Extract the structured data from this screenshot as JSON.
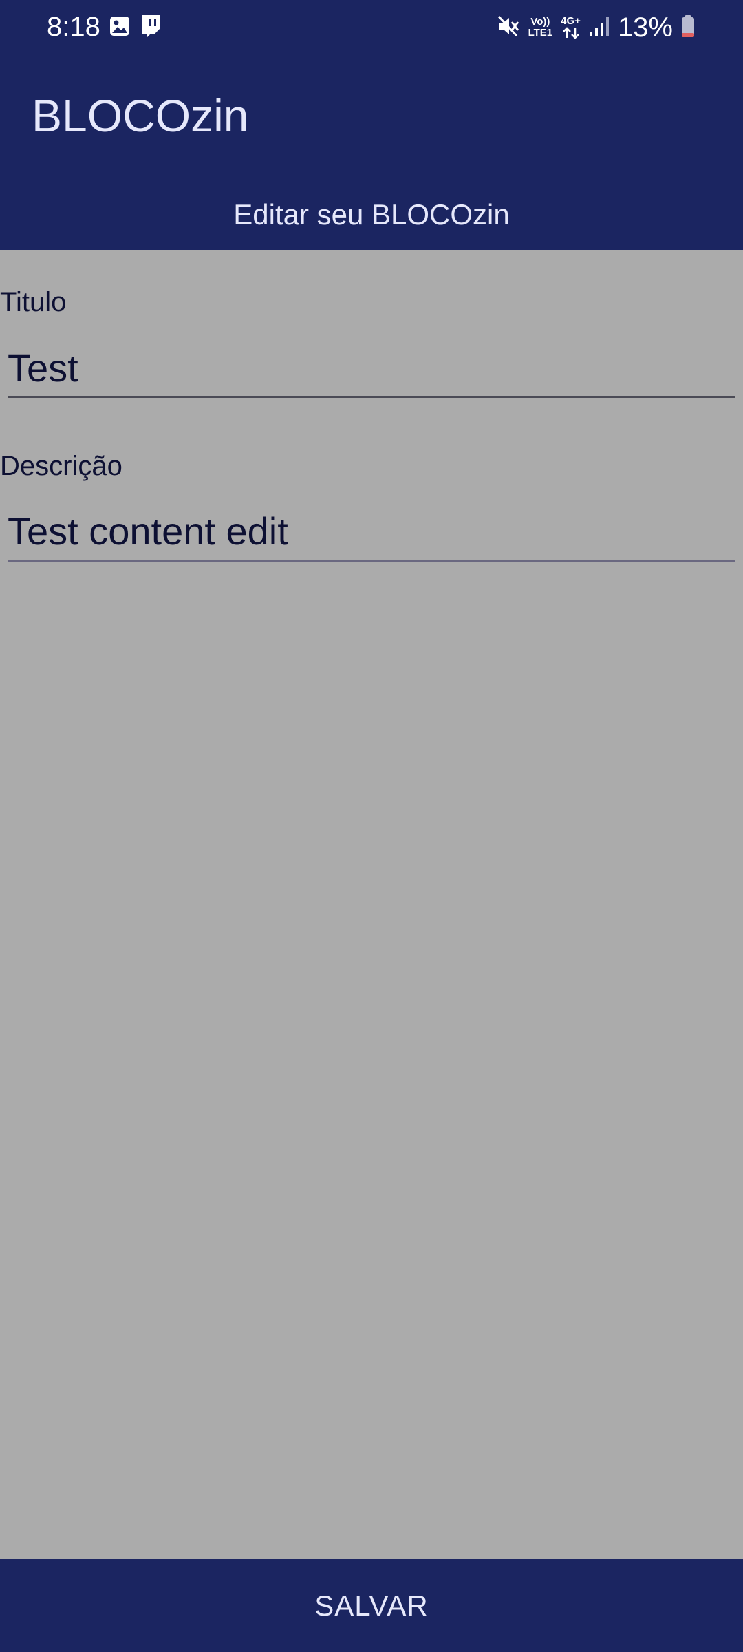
{
  "status_bar": {
    "time": "8:18",
    "battery_percent": "13%",
    "network": {
      "volte_top": "Vo))",
      "volte_bottom": "LTE1",
      "data_type": "4G+"
    },
    "left_icons": [
      "gallery-icon",
      "twitch-icon"
    ],
    "right_icons": [
      "mute-icon",
      "volte-icon",
      "data-icon",
      "signal-icon",
      "battery-icon"
    ]
  },
  "app_bar": {
    "title": "BLOCOzin"
  },
  "screen": {
    "subtitle": "Editar seu BLOCOzin"
  },
  "form": {
    "title_label": "Titulo",
    "title_value": "Test",
    "description_label": "Descrição",
    "description_value": "Test content edit"
  },
  "actions": {
    "save_label": "SALVAR"
  },
  "colors": {
    "primary": "#1b2561",
    "background": "#ababab",
    "text_on_primary": "#e6e8fb",
    "text_dark": "#0d1033",
    "battery_low": "#e06060"
  }
}
